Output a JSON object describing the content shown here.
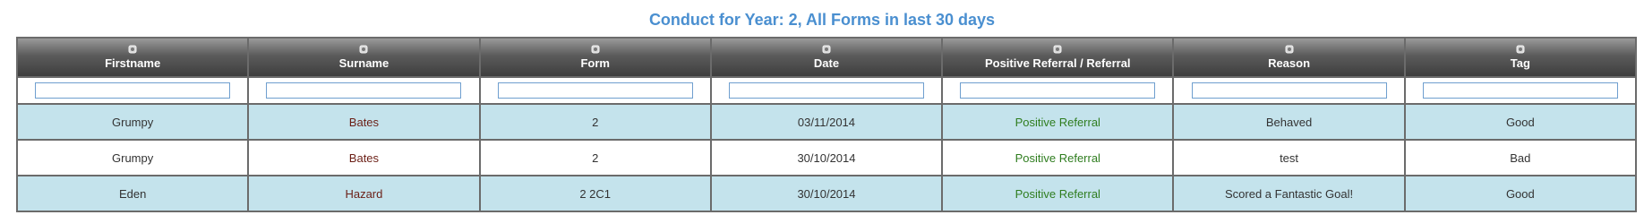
{
  "title": "Conduct for Year: 2, All Forms in last 30 days",
  "colors": {
    "title": "#4a8fd0",
    "row_alt": "#c4e3ec",
    "positive": "#2f7d1f",
    "surname": "#6b1f16"
  },
  "columns": [
    {
      "label": "Firstname",
      "icon": "sort-icon"
    },
    {
      "label": "Surname",
      "icon": "sort-icon"
    },
    {
      "label": "Form",
      "icon": "sort-icon"
    },
    {
      "label": "Date",
      "icon": "sort-icon"
    },
    {
      "label": "Positive Referral / Referral",
      "icon": "sort-icon"
    },
    {
      "label": "Reason",
      "icon": "sort-icon"
    },
    {
      "label": "Tag",
      "icon": "sort-icon"
    }
  ],
  "filters": [
    "",
    "",
    "",
    "",
    "",
    "",
    ""
  ],
  "rows": [
    {
      "firstname": "Grumpy",
      "surname": "Bates",
      "form": "2",
      "date": "03/11/2014",
      "type": "Positive Referral",
      "reason": "Behaved",
      "tag": "Good"
    },
    {
      "firstname": "Grumpy",
      "surname": "Bates",
      "form": "2",
      "date": "30/10/2014",
      "type": "Positive Referral",
      "reason": "test",
      "tag": "Bad"
    },
    {
      "firstname": "Eden",
      "surname": "Hazard",
      "form": "2 2C1",
      "date": "30/10/2014",
      "type": "Positive Referral",
      "reason": "Scored a Fantastic Goal!",
      "tag": "Good"
    }
  ]
}
